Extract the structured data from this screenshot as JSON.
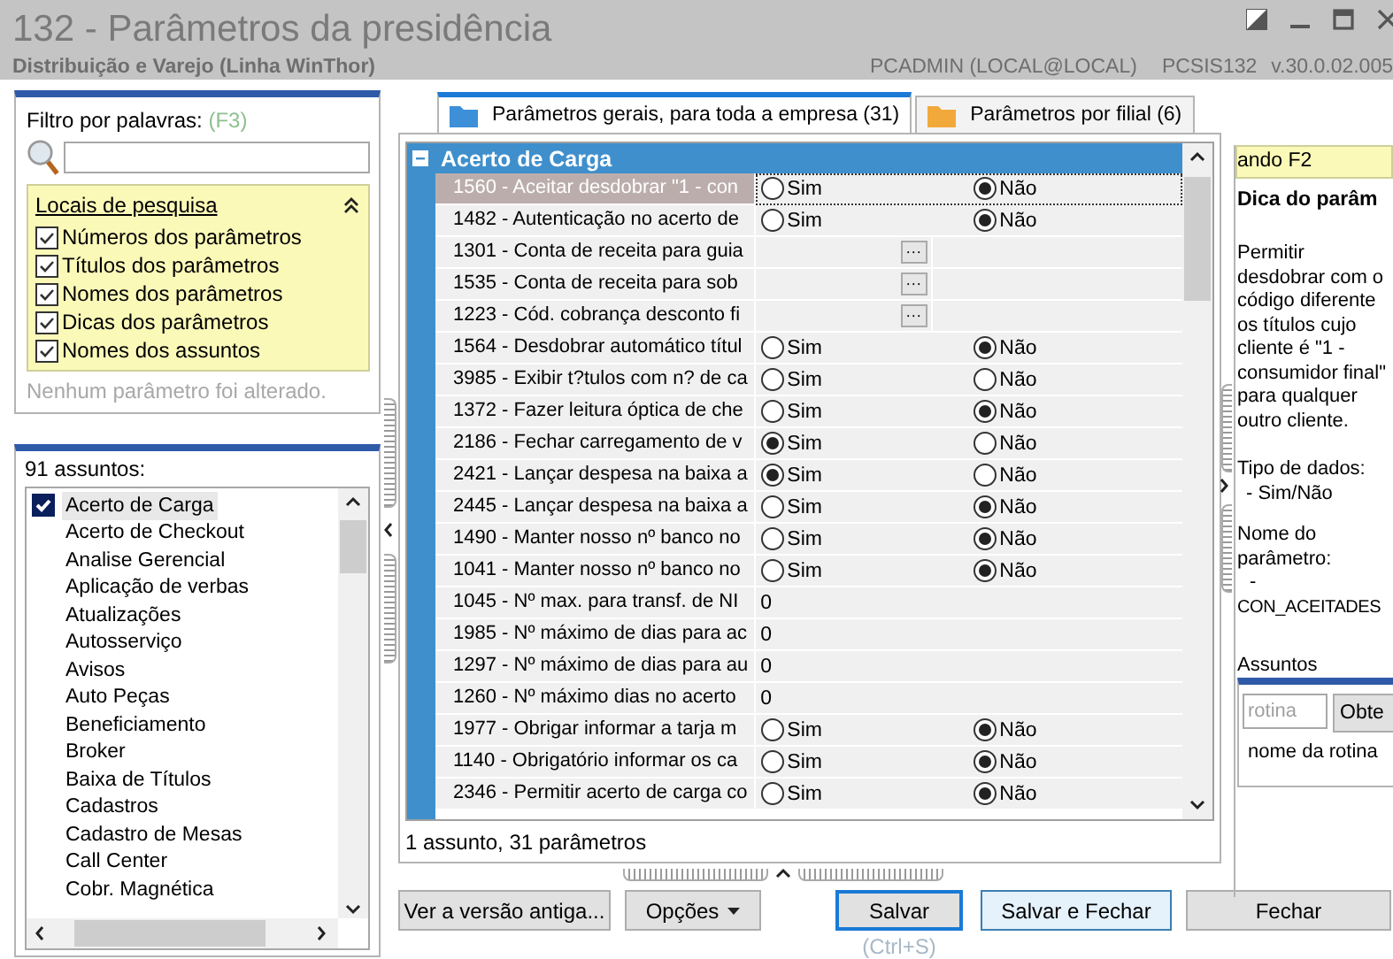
{
  "window": {
    "title": "132 - Parâmetros da presidência",
    "subtitle": "Distribuição e Varejo (Linha WinThor)",
    "user": "PCADMIN (LOCAL@LOCAL)",
    "routine": "PCSIS132",
    "version": "v.30.0.02.005"
  },
  "filter": {
    "label": "Filtro por palavras:",
    "shortcut": "(F3)",
    "search_places": {
      "title": "Locais de pesquisa",
      "expanded": true,
      "options": [
        {
          "label": "Números dos parâmetros",
          "checked": true
        },
        {
          "label": "Títulos dos parâmetros",
          "checked": true
        },
        {
          "label": "Nomes dos parâmetros",
          "checked": true
        },
        {
          "label": "Dicas dos parâmetros",
          "checked": true
        },
        {
          "label": "Nomes dos assuntos",
          "checked": true
        }
      ]
    },
    "status": "Nenhum parâmetro foi alterado."
  },
  "subjects": {
    "count": "91 assuntos:",
    "items": [
      {
        "label": "Acerto de Carga",
        "checked": true
      },
      {
        "label": "Acerto de Checkout",
        "checked": false
      },
      {
        "label": "Analise Gerencial",
        "checked": false
      },
      {
        "label": "Aplicação de verbas",
        "checked": false
      },
      {
        "label": "Atualizações",
        "checked": false
      },
      {
        "label": "Autosserviço",
        "checked": false
      },
      {
        "label": "Avisos",
        "checked": false
      },
      {
        "label": "Auto Peças",
        "checked": false
      },
      {
        "label": "Beneficiamento",
        "checked": false
      },
      {
        "label": "Broker",
        "checked": false
      },
      {
        "label": "Baixa de Títulos",
        "checked": false
      },
      {
        "label": "Cadastros",
        "checked": false
      },
      {
        "label": "Cadastro de Mesas",
        "checked": false
      },
      {
        "label": "Call Center",
        "checked": false
      },
      {
        "label": "Cobr. Magnética",
        "checked": false
      }
    ]
  },
  "tabs": [
    {
      "label": "Parâmetros gerais, para toda a empresa (31)",
      "selected": true,
      "color": "#3d8fd8"
    },
    {
      "label": "Parâmetros por filial (6)",
      "selected": false,
      "color": "#f2a93b"
    }
  ],
  "grid": {
    "group": {
      "title": "Acerto de Carga",
      "expanded": true
    },
    "rows": [
      {
        "name": "1560 - Aceitar desdobrar \"1 - con",
        "kind": "radio",
        "selected": true,
        "options": [
          {
            "label": "Sim",
            "selected": false
          },
          {
            "label": "Não",
            "selected": true
          }
        ]
      },
      {
        "name": "1482 - Autenticação no acerto de",
        "kind": "radio",
        "selected": false,
        "options": [
          {
            "label": "Sim",
            "selected": false
          },
          {
            "label": "Não",
            "selected": true
          }
        ]
      },
      {
        "name": "1301 - Conta de receita para guia",
        "kind": "lookup",
        "selected": false,
        "button": "···"
      },
      {
        "name": "1535 - Conta de receita para sob",
        "kind": "lookup",
        "selected": false,
        "button": "···"
      },
      {
        "name": "1223 - Cód. cobrança desconto fi",
        "kind": "lookup",
        "selected": false,
        "button": "···"
      },
      {
        "name": "1564 - Desdobrar automático títul",
        "kind": "radio",
        "selected": false,
        "options": [
          {
            "label": "Sim",
            "selected": false
          },
          {
            "label": "Não",
            "selected": true
          }
        ]
      },
      {
        "name": "3985 - Exibir t?tulos com n? de ca",
        "kind": "radio",
        "selected": false,
        "options": [
          {
            "label": "Sim",
            "selected": false
          },
          {
            "label": "Não",
            "selected": false
          }
        ]
      },
      {
        "name": "1372 - Fazer leitura óptica de che",
        "kind": "radio",
        "selected": false,
        "options": [
          {
            "label": "Sim",
            "selected": false
          },
          {
            "label": "Não",
            "selected": true
          }
        ]
      },
      {
        "name": "2186 - Fechar carregamento de v",
        "kind": "radio",
        "selected": false,
        "options": [
          {
            "label": "Sim",
            "selected": true
          },
          {
            "label": "Não",
            "selected": false
          }
        ]
      },
      {
        "name": "2421 - Lançar despesa na baixa a",
        "kind": "radio",
        "selected": false,
        "options": [
          {
            "label": "Sim",
            "selected": true
          },
          {
            "label": "Não",
            "selected": false
          }
        ]
      },
      {
        "name": "2445 - Lançar despesa na baixa a",
        "kind": "radio",
        "selected": false,
        "options": [
          {
            "label": "Sim",
            "selected": false
          },
          {
            "label": "Não",
            "selected": true
          }
        ]
      },
      {
        "name": "1490 - Manter nosso nº banco no",
        "kind": "radio",
        "selected": false,
        "options": [
          {
            "label": "Sim",
            "selected": false
          },
          {
            "label": "Não",
            "selected": true
          }
        ]
      },
      {
        "name": "1041 - Manter nosso nº banco no",
        "kind": "radio",
        "selected": false,
        "options": [
          {
            "label": "Sim",
            "selected": false
          },
          {
            "label": "Não",
            "selected": true
          }
        ]
      },
      {
        "name": "1045 - Nº max. para transf. de NI",
        "kind": "number",
        "selected": false,
        "value": "0"
      },
      {
        "name": "1985 - Nº máximo de dias para ac",
        "kind": "number",
        "selected": false,
        "value": "0"
      },
      {
        "name": "1297 - Nº máximo de dias para au",
        "kind": "number",
        "selected": false,
        "value": "0"
      },
      {
        "name": "1260 - Nº máximo dias no acerto",
        "kind": "number",
        "selected": false,
        "value": "0"
      },
      {
        "name": "1977 - Obrigar informar a tarja m",
        "kind": "radio",
        "selected": false,
        "options": [
          {
            "label": "Sim",
            "selected": false
          },
          {
            "label": "Não",
            "selected": true
          }
        ]
      },
      {
        "name": "1140 - Obrigatório informar os ca",
        "kind": "radio",
        "selected": false,
        "options": [
          {
            "label": "Sim",
            "selected": false
          },
          {
            "label": "Não",
            "selected": true
          }
        ]
      },
      {
        "name": "2346 - Permitir acerto de carga co",
        "kind": "radio",
        "selected": false,
        "options": [
          {
            "label": "Sim",
            "selected": false
          },
          {
            "label": "Não",
            "selected": true
          }
        ]
      }
    ],
    "footer": "1 assunto, 31 parâmetros"
  },
  "tip": {
    "shortcut": "ando F2",
    "title": "Dica do parâm",
    "text": "Permitir desdobrar com o código diferente os títulos cujo cliente é \"1 - consumidor final\" para qualquer outro cliente.",
    "type_label": "Tipo de dados:",
    "type_value": "- Sim/Não",
    "name_label": "Nome do parâmetro:",
    "name_dash": "-",
    "name_value": "CON_ACEITADES",
    "subjects_label": "Assuntos",
    "search_placeholder": "rotina",
    "search_button": "Obte",
    "hint": "nome da rotina"
  },
  "buttons": [
    {
      "label": "Ver a versão antiga...",
      "kind": "plain"
    },
    {
      "label": "Opções",
      "kind": "menu"
    },
    {
      "label": "Salvar",
      "kind": "default",
      "hint": "(Ctrl+S)"
    },
    {
      "label": "Salvar e Fechar",
      "kind": "hover"
    },
    {
      "label": "Fechar",
      "kind": "plain"
    }
  ]
}
